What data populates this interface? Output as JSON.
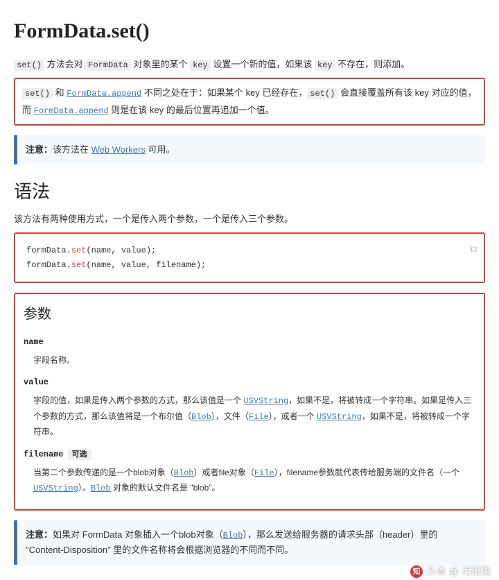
{
  "title": "FormData.set()",
  "intro": {
    "p1_a": "set()",
    "p1_b": " 方法会对 ",
    "p1_c": "FormData",
    "p1_d": " 对象里的某个 ",
    "p1_e": "key",
    "p1_f": " 设置一个新的值，如果该 ",
    "p1_g": "key",
    "p1_h": " 不存在，则添加。"
  },
  "diff": {
    "a": "set()",
    "b": " 和 ",
    "link1": "FormData.append",
    "c": " 不同之处在于：如果某个 key 已经存在，",
    "d": "set()",
    "e": " 会直接覆盖所有该 key 对应的值，而 ",
    "link2": "FormData.append",
    "f": " 则是在该 key 的最后位置再追加一个值。"
  },
  "note1": {
    "label": "注意：",
    "text": "该方法在 ",
    "link": "Web Workers",
    "after": " 可用。"
  },
  "syntax": {
    "heading": "语法",
    "desc": "该方法有两种使用方式，一个是传入两个参数，一个是传入三个参数。",
    "code": {
      "line1_pre": "formData.",
      "line1_fn": "set",
      "line1_post": "(name, value);",
      "line2_pre": "formData.",
      "line2_fn": "set",
      "line2_post": "(name, value, filename);"
    }
  },
  "params": {
    "heading": "参数",
    "name": {
      "term": "name",
      "desc": "字段名称。"
    },
    "value": {
      "term": "value",
      "desc_a": "字段的值，如果是传入两个参数的方式，那么该值是一个 ",
      "link1": "USVString",
      "desc_b": "，如果不是，将被转成一个字符串。如果是传入三个参数的方式，那么该值将是一个布尔值（",
      "link2": "Blob",
      "desc_c": "），文件（",
      "link3": "File",
      "desc_d": "），或者一个 ",
      "link4": "USVString",
      "desc_e": "，如果不是，将被转成一个字符串。"
    },
    "filename": {
      "term": "filename",
      "optional": "可选",
      "desc_a": "当第二个参数传递的是一个blob对象（",
      "link1": "Blob",
      "desc_b": "）或者file对象（",
      "link2": "File",
      "desc_c": "），filename参数就代表传给服务端的文件名（一个 ",
      "link3": "USVString",
      "desc_d": "）。",
      "link4": "Blob",
      "desc_e": " 对象的默认文件名是 \"blob\"。"
    }
  },
  "note2": {
    "label": "注意：",
    "a": "如果对 FormData 对象插入一个blob对象（",
    "link": "Blob",
    "b": "），那么发送给服务器的请求头部（header）里的 \"Content-Disposition\" 里的文件名称将会根据浏览器的不同而不同。"
  },
  "watermark": {
    "brand": "知",
    "text": "头条 @ 污斑兔"
  }
}
